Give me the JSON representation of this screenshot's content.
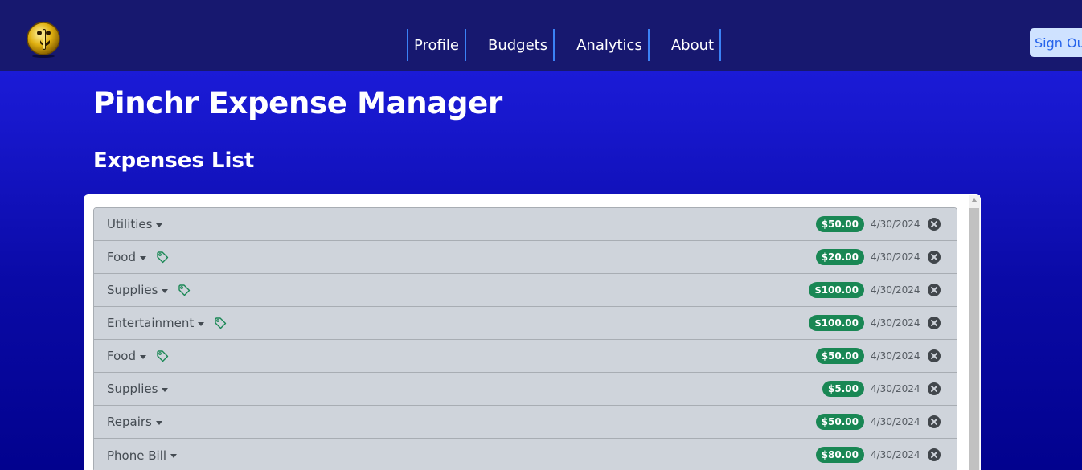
{
  "header": {
    "nav": [
      {
        "label": "Profile"
      },
      {
        "label": "Budgets"
      },
      {
        "label": "Analytics"
      },
      {
        "label": "About"
      }
    ],
    "sign_out": "Sign Out"
  },
  "main": {
    "title": "Pinchr Expense Manager",
    "subtitle": "Expenses List"
  },
  "expenses": [
    {
      "category": "Utilities",
      "tagged": false,
      "amount": "$50.00",
      "date": "4/30/2024"
    },
    {
      "category": "Food",
      "tagged": true,
      "amount": "$20.00",
      "date": "4/30/2024"
    },
    {
      "category": "Supplies",
      "tagged": true,
      "amount": "$100.00",
      "date": "4/30/2024"
    },
    {
      "category": "Entertainment",
      "tagged": true,
      "amount": "$100.00",
      "date": "4/30/2024"
    },
    {
      "category": "Food",
      "tagged": true,
      "amount": "$50.00",
      "date": "4/30/2024"
    },
    {
      "category": "Supplies",
      "tagged": false,
      "amount": "$5.00",
      "date": "4/30/2024"
    },
    {
      "category": "Repairs",
      "tagged": false,
      "amount": "$50.00",
      "date": "4/30/2024"
    },
    {
      "category": "Phone Bill",
      "tagged": false,
      "amount": "$80.00",
      "date": "4/30/2024"
    }
  ],
  "icons": {
    "logo": "smiley-coin-icon",
    "caret": "caret-down-icon",
    "tag": "tag-icon",
    "delete": "circle-x-icon"
  },
  "colors": {
    "navbar": "#17186f",
    "accent_border": "#3b82f6",
    "amount_badge": "#198754",
    "tag_icon": "#198754",
    "row_bg": "#cfd4db"
  }
}
